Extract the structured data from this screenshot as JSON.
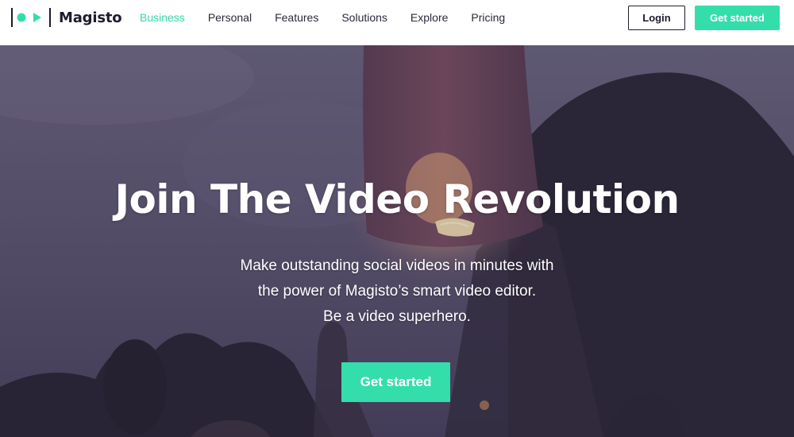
{
  "brand": {
    "name": "Magisto",
    "accent_color": "#34deaa",
    "logo_icons": [
      "separator-icon",
      "record-dot-icon",
      "play-icon",
      "separator-icon"
    ]
  },
  "nav": {
    "items": [
      {
        "label": "Business",
        "active": true
      },
      {
        "label": "Personal",
        "active": false
      },
      {
        "label": "Features",
        "active": false
      },
      {
        "label": "Solutions",
        "active": false
      },
      {
        "label": "Explore",
        "active": false
      },
      {
        "label": "Pricing",
        "active": false
      }
    ]
  },
  "header": {
    "login_label": "Login",
    "cta_label": "Get started"
  },
  "hero": {
    "title": "Join The Video Revolution",
    "subtitle_lines": [
      "Make outstanding social videos in minutes with",
      "the power of Magisto’s smart video editor.",
      "Be a video superhero."
    ],
    "cta_label": "Get started",
    "background": "sky lantern at dusk"
  }
}
